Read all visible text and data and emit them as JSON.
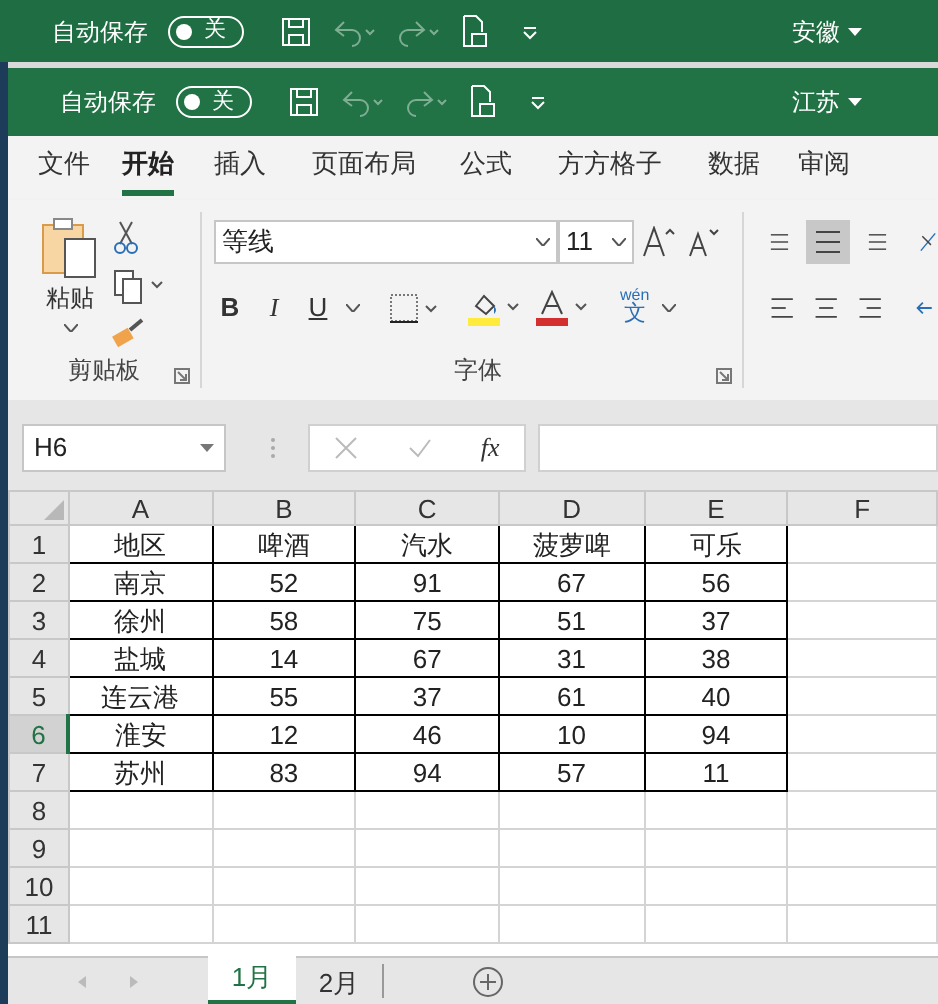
{
  "background_window": {
    "autosave_label": "自动保存",
    "autosave_toggle": {
      "label": "关",
      "on": false
    },
    "account": "安徽"
  },
  "window": {
    "autosave_label": "自动保存",
    "autosave_toggle": {
      "label": "关",
      "on": false
    },
    "account": "江苏"
  },
  "ribbon_tabs": [
    {
      "label": "文件",
      "selected": false
    },
    {
      "label": "开始",
      "selected": true
    },
    {
      "label": "插入",
      "selected": false
    },
    {
      "label": "页面布局",
      "selected": false
    },
    {
      "label": "公式",
      "selected": false
    },
    {
      "label": "方方格子",
      "selected": false
    },
    {
      "label": "数据",
      "selected": false
    },
    {
      "label": "审阅",
      "selected": false
    }
  ],
  "ribbon": {
    "clipboard": {
      "paste_label": "粘贴",
      "group_label": "剪贴板"
    },
    "font": {
      "font_name": "等线",
      "font_size": "11",
      "bold": "B",
      "italic": "I",
      "underline": "U",
      "phonetic_top": "wén",
      "phonetic_bottom": "文",
      "group_label": "字体"
    }
  },
  "formula_bar": {
    "name_box": "H6",
    "fx": "fx"
  },
  "columns": [
    {
      "label": "A",
      "selected": false
    },
    {
      "label": "B",
      "selected": false
    },
    {
      "label": "C",
      "selected": false
    },
    {
      "label": "D",
      "selected": false
    },
    {
      "label": "E",
      "selected": false
    },
    {
      "label": "F",
      "selected": false
    }
  ],
  "rows": [
    {
      "number": "1",
      "selected": false,
      "cells": [
        "地区",
        "啤酒",
        "汽水",
        "菠萝啤",
        "可乐"
      ]
    },
    {
      "number": "2",
      "selected": false,
      "cells": [
        "南京",
        "52",
        "91",
        "67",
        "56"
      ]
    },
    {
      "number": "3",
      "selected": false,
      "cells": [
        "徐州",
        "58",
        "75",
        "51",
        "37"
      ]
    },
    {
      "number": "4",
      "selected": false,
      "cells": [
        "盐城",
        "14",
        "67",
        "31",
        "38"
      ]
    },
    {
      "number": "5",
      "selected": false,
      "cells": [
        "连云港",
        "55",
        "37",
        "61",
        "40"
      ]
    },
    {
      "number": "6",
      "selected": true,
      "cells": [
        "淮安",
        "12",
        "46",
        "10",
        "94"
      ]
    },
    {
      "number": "7",
      "selected": false,
      "cells": [
        "苏州",
        "83",
        "94",
        "57",
        "11"
      ]
    },
    {
      "number": "8",
      "selected": false,
      "cells": []
    },
    {
      "number": "9",
      "selected": false,
      "cells": []
    },
    {
      "number": "10",
      "selected": false,
      "cells": []
    },
    {
      "number": "11",
      "selected": false,
      "cells": []
    }
  ],
  "sheet_tabs": [
    {
      "label": "1月",
      "selected": true
    },
    {
      "label": "2月",
      "selected": false
    }
  ]
}
